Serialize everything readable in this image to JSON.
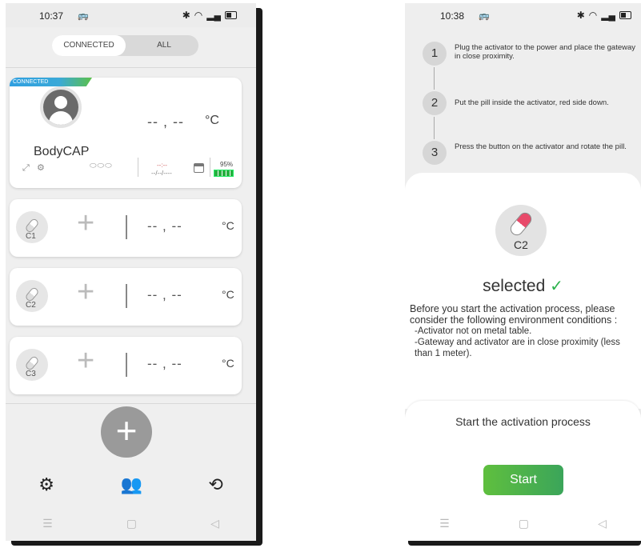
{
  "left_screen": {
    "status": {
      "time": "10:37",
      "sim_icon": "🚌"
    },
    "segment": {
      "connected": "CONNECTED",
      "all": "ALL"
    },
    "main_card": {
      "tag": "CONNECTED",
      "temp": "-- , --",
      "unit": "°C",
      "name": "BodyCAP",
      "small_red": "--:--",
      "small_date": "--/--/----",
      "battery": "95%",
      "battery_level": 0.95
    },
    "capsules": [
      {
        "label": "C1",
        "plus": "+",
        "temp": "-- , --",
        "unit": "°C"
      },
      {
        "label": "C2",
        "plus": "+",
        "temp": "-- , --",
        "unit": "°C"
      },
      {
        "label": "C3",
        "plus": "+",
        "temp": "-- , --",
        "unit": "°C"
      }
    ],
    "fab": "+",
    "nav_icons": [
      "gear-icon",
      "users-icon",
      "history-icon"
    ]
  },
  "right_screen": {
    "status": {
      "time": "10:38",
      "sim_icon": "🚌"
    },
    "steps": [
      {
        "num": "1",
        "text": "Plug the activator to the power and place the gateway in close proximity."
      },
      {
        "num": "2",
        "text": "Put the pill inside the activator, red side down."
      },
      {
        "num": "3",
        "text": "Press the button on the activator and rotate the pill."
      }
    ],
    "capsule_label": "C2",
    "selected": "selected",
    "info_main": "Before you start the activation process, please consider the following environment conditions :",
    "info_items": [
      "-Activator not on metal table.",
      "-Gateway and activator are in close proximity (less than 1 meter)."
    ],
    "activation_title": "Start the activation process",
    "start_button": "Start"
  },
  "system_nav": {
    "menu": "☰",
    "home": "▢",
    "back": "◁"
  }
}
